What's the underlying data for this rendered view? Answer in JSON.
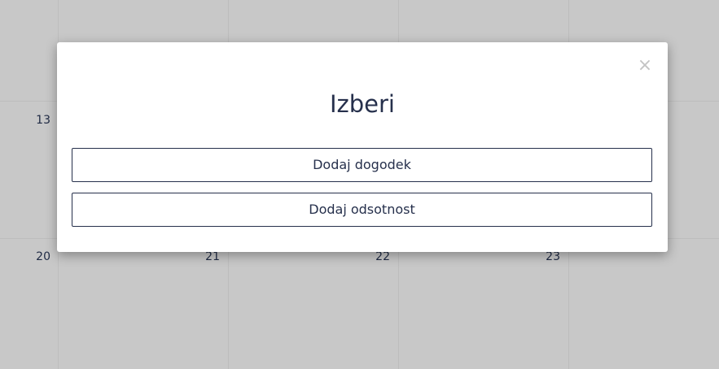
{
  "calendar": {
    "day_numbers": {
      "d13": "13",
      "d20": "20",
      "d21": "21",
      "d22": "22",
      "d23": "23"
    }
  },
  "modal": {
    "title": "Izberi",
    "close_symbol": "×",
    "buttons": {
      "add_event": "Dodaj dogodek",
      "add_absence": "Dodaj odsotnost"
    }
  },
  "colors": {
    "overlay_background": "#c8c8c8",
    "modal_background": "#ffffff",
    "primary_text": "#26304c",
    "close_icon": "#c4c4c4"
  },
  "icons": {
    "close": "close-icon"
  }
}
